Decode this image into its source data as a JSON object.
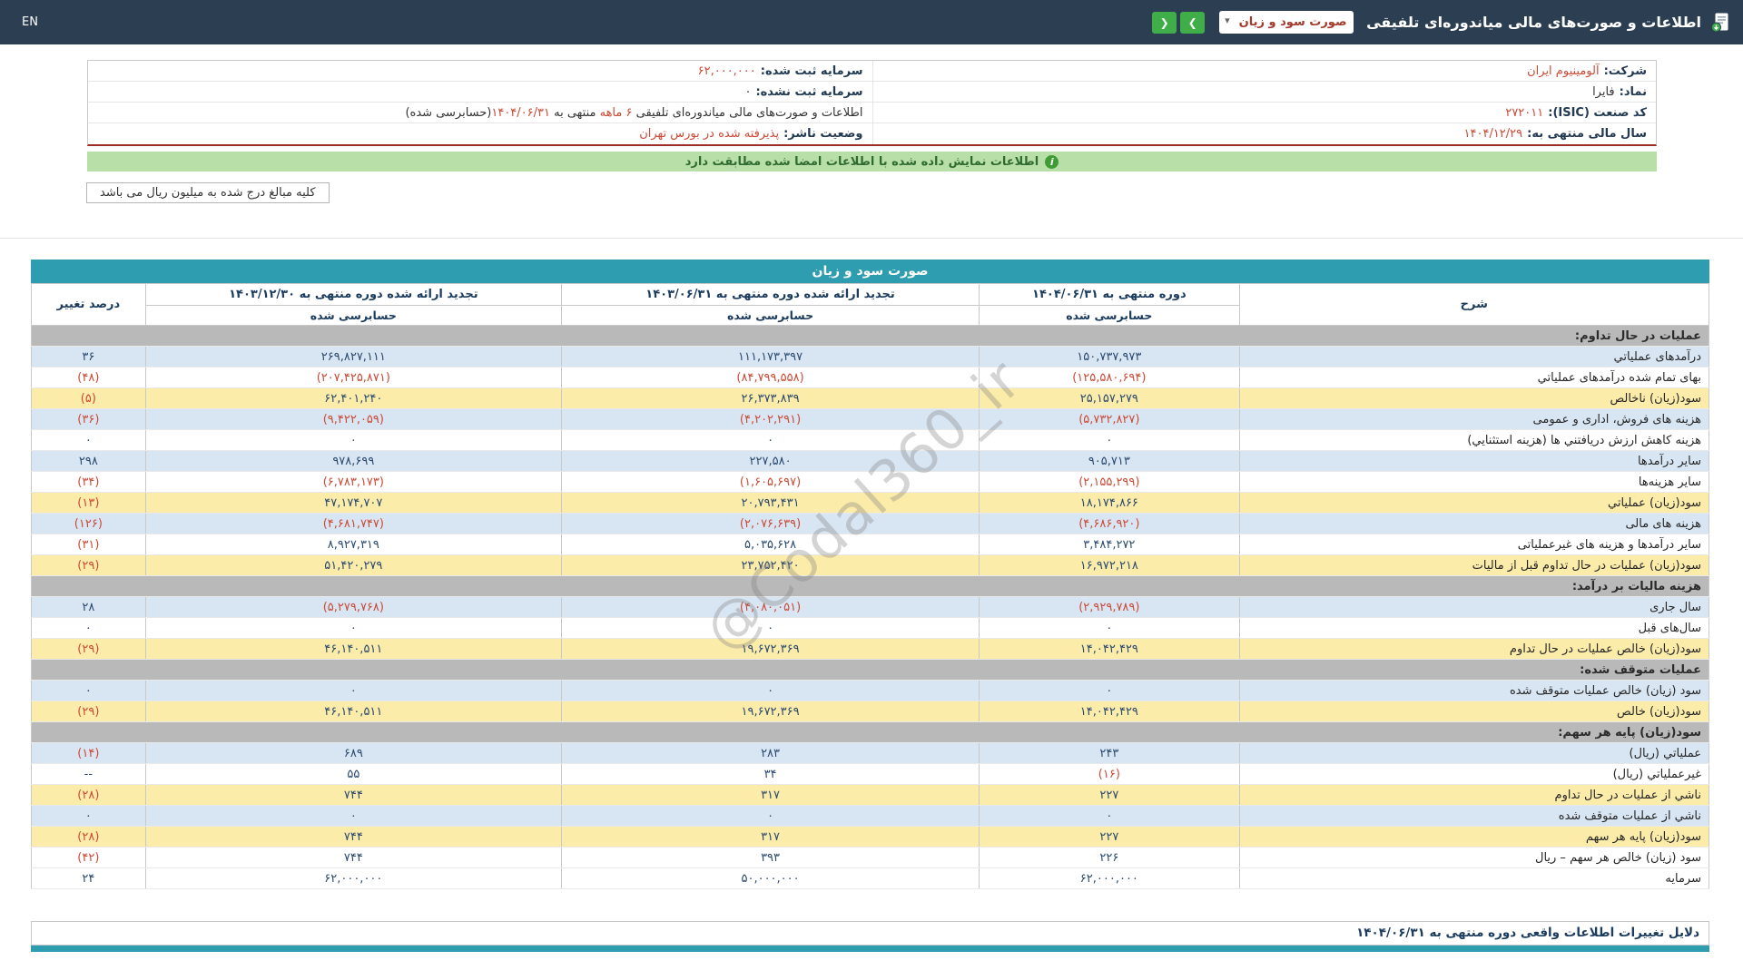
{
  "header": {
    "title": "اطلاعات و صورت‌های مالی میاندوره‌ای تلفیقی",
    "statement_select": {
      "value": "صورت سود و زیان"
    },
    "nav": {
      "next": "❯",
      "prev": "❮"
    },
    "language": "EN"
  },
  "company_info": {
    "right_rows": [
      {
        "label": "شرکت:",
        "value": "آلومینیوم ایران",
        "red": true
      },
      {
        "label": "نماد:",
        "value": "فایرا",
        "red": false
      },
      {
        "label": "کد صنعت (ISIC):",
        "value": "۲۷۲۰۱۱",
        "red": true
      },
      {
        "label": "سال مالی منتهی به:",
        "value": "۱۴۰۴/۱۲/۲۹",
        "red": true
      }
    ],
    "left_rows": [
      {
        "label": "سرمایه ثبت شده:",
        "value": "۶۲,۰۰۰,۰۰۰",
        "red": true
      },
      {
        "label": "سرمایه ثبت نشده:",
        "value": "۰",
        "red": false
      },
      {
        "segments": [
          {
            "text": "اطلاعات و صورت‌های مالی میاندوره‌ای تلفیقی ",
            "red": false
          },
          {
            "text": "۶ ماهه",
            "red": true
          },
          {
            "text": " منتهی به ",
            "red": false
          },
          {
            "text": "۱۴۰۴/۰۶/۳۱",
            "red": true
          },
          {
            "text": "(حسابرسی شده)",
            "red": false
          }
        ]
      },
      {
        "label": "وضعیت ناشر:",
        "value": "پذیرفته شده در بورس تهران",
        "red": true
      }
    ]
  },
  "banner": {
    "icon": "i",
    "text": "اطلاعات نمایش داده شده با اطلاعات امضا شده مطابقت دارد"
  },
  "unit_note": "کلیه مبالغ درج شده به میلیون ریال می باشد",
  "statement": {
    "title": "صورت سود و زیان",
    "columns": {
      "desc": "شرح",
      "p1": "دوره منتهی به ۱۴۰۴/۰۶/۳۱",
      "p2": "تجدید ارائه شده دوره منتهی به ۱۴۰۳/۰۶/۳۱",
      "p3": "تجدید ارائه شده دوره منتهی به ۱۴۰۳/۱۲/۳۰",
      "audited": "حسابرسی شده",
      "pct": "درصد تغییر"
    },
    "rows": [
      {
        "type": "section",
        "label": "عملیات در حال تداوم:"
      },
      {
        "type": "data",
        "bg": "blue",
        "label": "درآمدهای عملیاتي",
        "v1": "۱۵۰,۷۳۷,۹۷۳",
        "v2": "۱۱۱,۱۷۳,۳۹۷",
        "v3": "۲۶۹,۸۲۷,۱۱۱",
        "pct": "۳۶"
      },
      {
        "type": "data",
        "bg": "white",
        "label": "بهای تمام شده درآمدهای عملیاتي",
        "v1": "(۱۲۵,۵۸۰,۶۹۴)",
        "v2": "(۸۴,۷۹۹,۵۵۸)",
        "v3": "(۲۰۷,۴۲۵,۸۷۱)",
        "pct": "(۴۸)"
      },
      {
        "type": "data",
        "bg": "yellow",
        "label": "سود(زیان) ناخالص",
        "v1": "۲۵,۱۵۷,۲۷۹",
        "v2": "۲۶,۳۷۳,۸۳۹",
        "v3": "۶۲,۴۰۱,۲۴۰",
        "pct": "(۵)"
      },
      {
        "type": "data",
        "bg": "blue",
        "label": "هزینه های فروش، اداری و عمومی",
        "v1": "(۵,۷۳۲,۸۲۷)",
        "v2": "(۴,۲۰۲,۲۹۱)",
        "v3": "(۹,۴۲۲,۰۵۹)",
        "pct": "(۳۶)"
      },
      {
        "type": "data",
        "bg": "white",
        "label": "هزینه کاهش ارزش دریافتني ها (هزینه استثنایي)",
        "v1": "۰",
        "v2": "۰",
        "v3": "۰",
        "pct": "۰"
      },
      {
        "type": "data",
        "bg": "blue",
        "label": "سایر درآمدها",
        "v1": "۹۰۵,۷۱۳",
        "v2": "۲۲۷,۵۸۰",
        "v3": "۹۷۸,۶۹۹",
        "pct": "۲۹۸"
      },
      {
        "type": "data",
        "bg": "white",
        "label": "سایر هزینه‌ها",
        "v1": "(۲,۱۵۵,۲۹۹)",
        "v2": "(۱,۶۰۵,۶۹۷)",
        "v3": "(۶,۷۸۳,۱۷۳)",
        "pct": "(۳۴)"
      },
      {
        "type": "data",
        "bg": "yellow",
        "label": "سود(زیان) عملیاتي",
        "v1": "۱۸,۱۷۴,۸۶۶",
        "v2": "۲۰,۷۹۳,۴۳۱",
        "v3": "۴۷,۱۷۴,۷۰۷",
        "pct": "(۱۳)"
      },
      {
        "type": "data",
        "bg": "blue",
        "label": "هزینه های مالی",
        "v1": "(۴,۶۸۶,۹۲۰)",
        "v2": "(۲,۰۷۶,۶۳۹)",
        "v3": "(۴,۶۸۱,۷۴۷)",
        "pct": "(۱۲۶)"
      },
      {
        "type": "data",
        "bg": "white",
        "label": "سایر درآمدها و هزینه های غیرعملیاتی",
        "v1": "۳,۴۸۴,۲۷۲",
        "v2": "۵,۰۳۵,۶۲۸",
        "v3": "۸,۹۲۷,۳۱۹",
        "pct": "(۳۱)"
      },
      {
        "type": "data",
        "bg": "yellow",
        "label": "سود(زیان) عملیات در حال تداوم قبل از مالیات",
        "v1": "۱۶,۹۷۲,۲۱۸",
        "v2": "۲۳,۷۵۲,۴۲۰",
        "v3": "۵۱,۴۲۰,۲۷۹",
        "pct": "(۲۹)"
      },
      {
        "type": "section",
        "label": "هزینه مالیات بر درآمد:"
      },
      {
        "type": "data",
        "bg": "blue",
        "label": "سال جاری",
        "v1": "(۲,۹۲۹,۷۸۹)",
        "v2": "(۴,۰۸۰,۰۵۱)",
        "v3": "(۵,۲۷۹,۷۶۸)",
        "pct": "۲۸"
      },
      {
        "type": "data",
        "bg": "white",
        "label": "سال‌های قبل",
        "v1": "۰",
        "v2": "۰",
        "v3": "۰",
        "pct": "۰"
      },
      {
        "type": "data",
        "bg": "yellow",
        "label": "سود(زیان) خالص عملیات در حال تداوم",
        "v1": "۱۴,۰۴۲,۴۲۹",
        "v2": "۱۹,۶۷۲,۳۶۹",
        "v3": "۴۶,۱۴۰,۵۱۱",
        "pct": "(۲۹)"
      },
      {
        "type": "section",
        "label": "عملیات متوقف شده:"
      },
      {
        "type": "data",
        "bg": "blue",
        "label": "سود (زیان) خالص عملیات متوقف شده",
        "v1": "۰",
        "v2": "۰",
        "v3": "۰",
        "pct": "۰"
      },
      {
        "type": "data",
        "bg": "yellow",
        "label": "سود(زیان) خالص",
        "v1": "۱۴,۰۴۲,۴۲۹",
        "v2": "۱۹,۶۷۲,۳۶۹",
        "v3": "۴۶,۱۴۰,۵۱۱",
        "pct": "(۲۹)"
      },
      {
        "type": "section",
        "label": "سود(زیان) پایه هر سهم:"
      },
      {
        "type": "data",
        "bg": "blue",
        "label": "عملیاتي (ریال)",
        "v1": "۲۴۳",
        "v2": "۲۸۳",
        "v3": "۶۸۹",
        "pct": "(۱۴)"
      },
      {
        "type": "data",
        "bg": "white",
        "label": "غیرعملیاتي (ریال)",
        "v1": "(۱۶)",
        "v2": "۳۴",
        "v3": "۵۵",
        "pct": "--"
      },
      {
        "type": "data",
        "bg": "yellow",
        "label": "ناشي از عملیات در حال تداوم",
        "v1": "۲۲۷",
        "v2": "۳۱۷",
        "v3": "۷۴۴",
        "pct": "(۲۸)"
      },
      {
        "type": "data",
        "bg": "blue",
        "label": "ناشي از عملیات متوقف شده",
        "v1": "۰",
        "v2": "۰",
        "v3": "۰",
        "pct": "۰"
      },
      {
        "type": "data",
        "bg": "yellow",
        "label": "سود(زیان) پایه هر سهم",
        "v1": "۲۲۷",
        "v2": "۳۱۷",
        "v3": "۷۴۴",
        "pct": "(۲۸)"
      },
      {
        "type": "data",
        "bg": "white",
        "label": "سود (زیان) خالص هر سهم – ریال",
        "v1": "۲۲۶",
        "v2": "۳۹۳",
        "v3": "۷۴۴",
        "pct": "(۴۲)"
      },
      {
        "type": "data",
        "bg": "white",
        "label": "سرمایه",
        "v1": "۶۲,۰۰۰,۰۰۰",
        "v2": "۵۰,۰۰۰,۰۰۰",
        "v3": "۶۲,۰۰۰,۰۰۰",
        "pct": "۲۴"
      }
    ]
  },
  "reasons_bar": "دلایل تغییرات اطلاعات واقعی دوره منتهی به ۱۴۰۴/۰۶/۳۱",
  "watermark": "@Codal360_ir",
  "colors": {
    "header_bg": "#2c3e52",
    "accent_teal": "#2f9db0",
    "positive_navy": "#2c4a6e",
    "negative_red": "#cc4a35",
    "highlight_yellow": "#fcecaa",
    "row_blue": "#d8e6f4",
    "section_gray": "#b9b9b9",
    "banner_green": "#b9dfa8",
    "button_green": "#3fae49"
  }
}
